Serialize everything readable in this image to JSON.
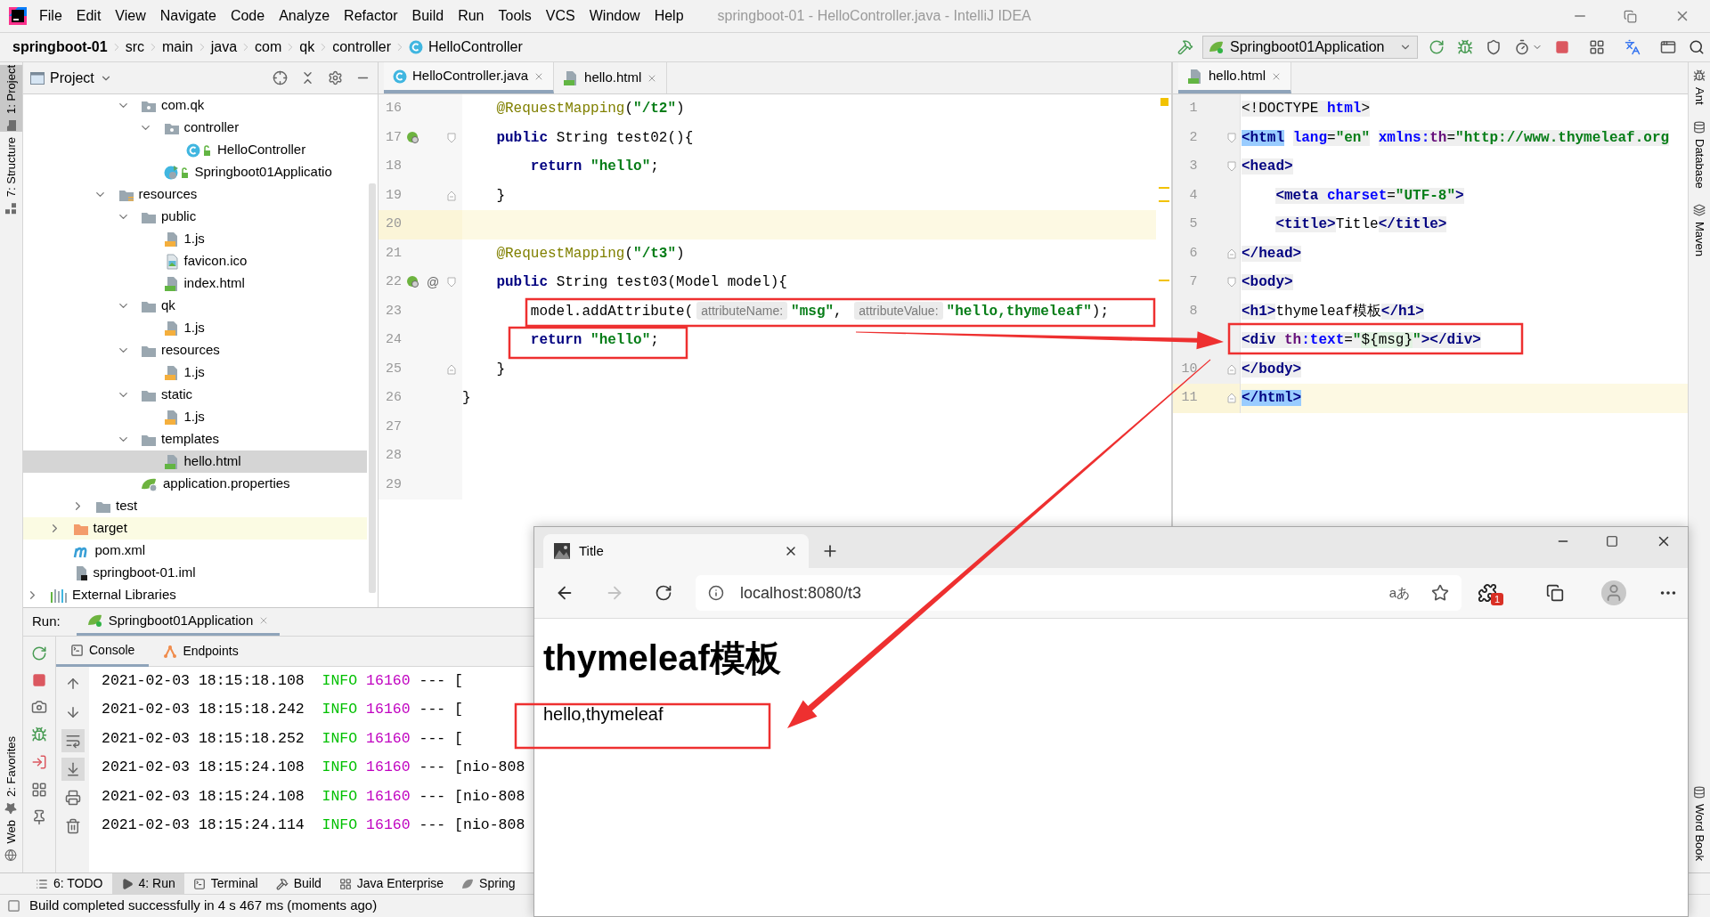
{
  "window": {
    "title": "springboot-01 - HelloController.java - IntelliJ IDEA"
  },
  "menu": [
    "File",
    "Edit",
    "View",
    "Navigate",
    "Code",
    "Analyze",
    "Refactor",
    "Build",
    "Run",
    "Tools",
    "VCS",
    "Window",
    "Help"
  ],
  "breadcrumbs": [
    "springboot-01",
    "src",
    "main",
    "java",
    "com",
    "qk",
    "controller",
    "HelloController"
  ],
  "run_config": "Springboot01Application",
  "left_stripe": {
    "top": [
      {
        "label": "1: Project",
        "selected": true
      },
      {
        "label": "7: Structure",
        "selected": false
      }
    ],
    "bottom": [
      "2: Favorites",
      "Web"
    ]
  },
  "right_stripe": {
    "top": [
      "Ant",
      "Database",
      "Maven"
    ],
    "bottom": [
      "Word Book"
    ]
  },
  "project": {
    "title": "Project",
    "tree": [
      {
        "children": [
          {
            "children": [
              {
                "children": [
                  {
                    "children": [
                      {
                        "label": "com.qk",
                        "kind": "package",
                        "expanded": true,
                        "selected": false,
                        "children": [
                          {
                            "label": "controller",
                            "kind": "package",
                            "expanded": true,
                            "selected": false,
                            "children": [
                              {
                                "label": "HelloController",
                                "kind": "class",
                                "selected": false
                              }
                            ]
                          },
                          {
                            "label": "Springboot01Applicatio",
                            "kind": "app-class",
                            "selected": false
                          }
                        ]
                      }
                    ]
                  },
                  {
                    "label": "resources",
                    "kind": "resources-folder",
                    "expanded": true,
                    "selected": false,
                    "children": [
                      {
                        "label": "public",
                        "kind": "folder",
                        "expanded": true,
                        "selected": false,
                        "children": [
                          {
                            "label": "1.js",
                            "kind": "js",
                            "selected": false
                          },
                          {
                            "label": "favicon.ico",
                            "kind": "ico",
                            "selected": false
                          },
                          {
                            "label": "index.html",
                            "kind": "html",
                            "selected": false
                          }
                        ]
                      },
                      {
                        "label": "qk",
                        "kind": "folder",
                        "expanded": true,
                        "selected": false,
                        "children": [
                          {
                            "label": "1.js",
                            "kind": "js",
                            "selected": false
                          }
                        ]
                      },
                      {
                        "label": "resources",
                        "kind": "folder",
                        "expanded": true,
                        "selected": false,
                        "children": [
                          {
                            "label": "1.js",
                            "kind": "js",
                            "selected": false
                          }
                        ]
                      },
                      {
                        "label": "static",
                        "kind": "folder",
                        "expanded": true,
                        "selected": false,
                        "children": [
                          {
                            "label": "1.js",
                            "kind": "js",
                            "selected": false
                          }
                        ]
                      },
                      {
                        "label": "templates",
                        "kind": "folder",
                        "expanded": true,
                        "selected": false,
                        "children": [
                          {
                            "label": "hello.html",
                            "kind": "html",
                            "selected": true
                          }
                        ]
                      },
                      {
                        "label": "application.properties",
                        "kind": "properties",
                        "selected": false
                      }
                    ]
                  }
                ]
              },
              {
                "label": "test",
                "kind": "folder",
                "expanded": false,
                "selected": false
              }
            ]
          },
          {
            "label": "target",
            "kind": "excluded-folder",
            "expanded": false,
            "selected": false
          },
          {
            "label": "pom.xml",
            "kind": "xml",
            "selected": false
          },
          {
            "label": "springboot-01.iml",
            "kind": "iml",
            "selected": false
          }
        ]
      },
      {
        "label": "External Libraries",
        "kind": "library",
        "expanded": false,
        "selected": false
      }
    ]
  },
  "editor_left": {
    "tabs": [
      {
        "label": "HelloController.java",
        "kind": "class",
        "selected": true
      },
      {
        "label": "hello.html",
        "kind": "html",
        "selected": false
      }
    ],
    "lines": [
      {
        "number": "16",
        "current": false,
        "tokens": [
          {
            "kind": "ann",
            "text": "    @RequestMapping"
          },
          {
            "kind": "plain",
            "text": "("
          },
          {
            "kind": "str",
            "text": "\"/t2\""
          },
          {
            "kind": "plain",
            "text": ")"
          }
        ]
      },
      {
        "number": "17",
        "current": false,
        "markers": [
          {
            "kind": "bean"
          },
          {
            "kind": "fold_start"
          }
        ],
        "tokens": [
          {
            "kind": "kw",
            "text": "    public"
          },
          {
            "kind": "plain",
            "text": " String test02(){"
          }
        ]
      },
      {
        "number": "18",
        "current": false,
        "tokens": [
          {
            "kind": "kw",
            "text": "        return"
          },
          {
            "kind": "str",
            "text": " \"hello\""
          },
          {
            "kind": "plain",
            "text": ";"
          }
        ]
      },
      {
        "number": "19",
        "current": false,
        "markers": [
          {
            "kind": "fold_end"
          }
        ],
        "tokens": [
          {
            "kind": "plain",
            "text": "    }"
          }
        ]
      },
      {
        "number": "20",
        "current": true
      },
      {
        "number": "21",
        "current": false,
        "tokens": [
          {
            "kind": "ann",
            "text": "    @RequestMapping"
          },
          {
            "kind": "plain",
            "text": "("
          },
          {
            "kind": "str",
            "text": "\"/t3\""
          },
          {
            "kind": "plain",
            "text": ")"
          }
        ]
      },
      {
        "number": "22",
        "current": false,
        "gutter_mark": "@",
        "markers": [
          {
            "kind": "bean"
          },
          {
            "kind": "fold_start"
          }
        ],
        "tokens": [
          {
            "kind": "kw",
            "text": "    public"
          },
          {
            "kind": "plain",
            "text": " String test03(Model model){"
          }
        ]
      },
      {
        "number": "23",
        "current": false,
        "tokens": [
          {
            "kind": "plain",
            "text": "        model.addAttribute("
          },
          {
            "kind": "hint",
            "text": "attributeName:"
          },
          {
            "kind": "str",
            "text": "\"msg\""
          },
          {
            "kind": "plain",
            "text": ", "
          },
          {
            "kind": "hint",
            "text": "attributeValue:"
          },
          {
            "kind": "str",
            "text": "\"hello,thymeleaf\""
          },
          {
            "kind": "plain",
            "text": ");"
          }
        ]
      },
      {
        "number": "24",
        "current": false,
        "tokens": [
          {
            "kind": "kw",
            "text": "        return"
          },
          {
            "kind": "str",
            "text": " \"hello\""
          },
          {
            "kind": "plain",
            "text": ";"
          }
        ]
      },
      {
        "number": "25",
        "current": false,
        "markers": [
          {
            "kind": "fold_end"
          }
        ],
        "tokens": [
          {
            "kind": "plain",
            "text": "    }"
          }
        ]
      },
      {
        "number": "26",
        "current": false,
        "tokens": [
          {
            "kind": "plain",
            "text": "}"
          }
        ]
      },
      {
        "number": "27",
        "current": false
      },
      {
        "number": "28",
        "current": false
      },
      {
        "number": "29",
        "current": false
      }
    ]
  },
  "editor_right": {
    "tabs": [
      {
        "label": "hello.html",
        "kind": "html",
        "selected": true
      }
    ],
    "lines": [
      {
        "number": "1",
        "current": false,
        "tokens": [
          {
            "kind": "punct",
            "text": "<!DOCTYPE "
          },
          {
            "kind": "attr",
            "text": "html"
          },
          {
            "kind": "punct",
            "text": ">"
          }
        ]
      },
      {
        "number": "2",
        "current": false,
        "markers": [
          {
            "kind": "fold_start"
          }
        ],
        "tokens": [
          {
            "kind": "match",
            "text": "<html"
          },
          {
            "kind": "attr",
            "text": " lang"
          },
          {
            "kind": "punct",
            "text": "="
          },
          {
            "kind": "val",
            "text": "\"en\""
          },
          {
            "kind": "attr",
            "text": " xmlns:"
          },
          {
            "kind": "ns",
            "text": "th"
          },
          {
            "kind": "punct",
            "text": "="
          },
          {
            "kind": "val",
            "text": "\"http://www.thymeleaf.org"
          }
        ]
      },
      {
        "number": "3",
        "current": false,
        "markers": [
          {
            "kind": "fold_start"
          }
        ],
        "tokens": [
          {
            "kind": "tag",
            "text": "<head>"
          }
        ]
      },
      {
        "number": "4",
        "current": false,
        "tokens": [
          {
            "kind": "tag",
            "text": "    <meta "
          },
          {
            "kind": "attr",
            "text": "charset"
          },
          {
            "kind": "punct",
            "text": "="
          },
          {
            "kind": "val",
            "text": "\"UTF-8\""
          },
          {
            "kind": "tag",
            "text": ">"
          }
        ]
      },
      {
        "number": "5",
        "current": false,
        "tokens": [
          {
            "kind": "tag",
            "text": "    <title>"
          },
          {
            "kind": "text",
            "text": "Title"
          },
          {
            "kind": "tag",
            "text": "</title>"
          }
        ]
      },
      {
        "number": "6",
        "current": false,
        "markers": [
          {
            "kind": "fold_end"
          }
        ],
        "tokens": [
          {
            "kind": "tag",
            "text": "</head>"
          }
        ]
      },
      {
        "number": "7",
        "current": false,
        "markers": [
          {
            "kind": "fold_start"
          }
        ],
        "tokens": [
          {
            "kind": "tag",
            "text": "<body>"
          }
        ]
      },
      {
        "number": "8",
        "current": false,
        "tokens": [
          {
            "kind": "tag",
            "text": "<h1>"
          },
          {
            "kind": "text",
            "text": "thymeleaf模板"
          },
          {
            "kind": "tag",
            "text": "</h1>"
          }
        ]
      },
      {
        "current": false,
        "tokens": [
          {
            "kind": "tag",
            "text": "<div "
          },
          {
            "kind": "ns",
            "text": "th"
          },
          {
            "kind": "attr",
            "text": ":text"
          },
          {
            "kind": "punct",
            "text": "="
          },
          {
            "kind": "val",
            "text": "\""
          },
          {
            "kind": "expr",
            "text": "${msg}"
          },
          {
            "kind": "val",
            "text": "\""
          },
          {
            "kind": "tag",
            "text": "></div>"
          }
        ]
      },
      {
        "number": "10",
        "current": false,
        "markers": [
          {
            "kind": "fold_end"
          }
        ],
        "tokens": [
          {
            "kind": "tag",
            "text": "</body>"
          }
        ]
      },
      {
        "number": "11",
        "current": true,
        "markers": [
          {
            "kind": "fold_end"
          }
        ],
        "tokens": [
          {
            "kind": "match",
            "text": "</html>"
          }
        ]
      }
    ]
  },
  "run": {
    "label": "Run:",
    "tab": {
      "label": "Springboot01Application",
      "selected": true
    },
    "subtabs": [
      {
        "label": "Console",
        "kind": "console",
        "selected": true
      },
      {
        "label": "Endpoints",
        "kind": "endpoints",
        "selected": false
      }
    ],
    "soft_wrap_on": true,
    "scroll_to_end_on": true,
    "lines": [
      {
        "time": "2021-02-03 18:15:18.108",
        "level": "INFO",
        "pid": "16160",
        "rest": "--- ["
      },
      {
        "time": "2021-02-03 18:15:18.242",
        "level": "INFO",
        "pid": "16160",
        "rest": "--- ["
      },
      {
        "time": "2021-02-03 18:15:18.252",
        "level": "INFO",
        "pid": "16160",
        "rest": "--- ["
      },
      {
        "time": "2021-02-03 18:15:24.108",
        "level": "INFO",
        "pid": "16160",
        "rest": "--- [nio-808"
      },
      {
        "time": "2021-02-03 18:15:24.108",
        "level": "INFO",
        "pid": "16160",
        "rest": "--- [nio-808"
      },
      {
        "time": "2021-02-03 18:15:24.114",
        "level": "INFO",
        "pid": "16160",
        "rest": "--- [nio-808"
      }
    ]
  },
  "bottom_tabs": [
    {
      "label": "6: TODO",
      "kind": "todo",
      "selected": false
    },
    {
      "label": "4: Run",
      "kind": "run",
      "selected": true
    },
    {
      "label": "Terminal",
      "kind": "terminal",
      "selected": false
    },
    {
      "label": "Build",
      "kind": "build",
      "selected": false
    },
    {
      "label": "Java Enterprise",
      "kind": "enterprise",
      "selected": false
    },
    {
      "label": "Spring",
      "kind": "spring",
      "selected": false
    }
  ],
  "status_bar": "Build completed successfully in 4 s 467 ms (moments ago)",
  "browser": {
    "tab": {
      "title": "Title",
      "selected": true
    },
    "forward_disabled": true,
    "address": "localhost:8080/t3",
    "read_aloud": "aあ",
    "extension_badge": "1",
    "page": {
      "heading": "thymeleaf模板",
      "text": "hello,thymeleaf"
    }
  }
}
